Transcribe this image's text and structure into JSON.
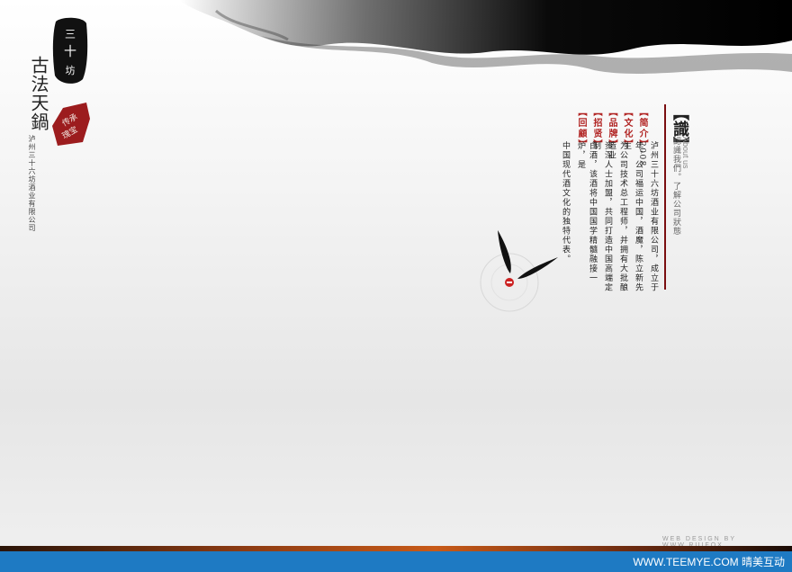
{
  "brand": {
    "logo_text": "三十六坊",
    "title": "古法天鍋",
    "seal_text": "传承·瑰宝",
    "company_name": "泸州三十六坊酒业有限公司"
  },
  "about": {
    "heading": "【識】",
    "english": "About us",
    "subtitle": "認識我們。了解公司狀態"
  },
  "nav": [
    {
      "label": "【简介】"
    },
    {
      "label": "【文化】"
    },
    {
      "label": "【品牌】"
    },
    {
      "label": "【招贤】"
    },
    {
      "label": "【回顧】"
    }
  ],
  "body_columns": [
    "泸州三十六坊酒业有限公司，成立于2008",
    "年，公司福运中国，酒魔，陈立新先生",
    "为公司技术总工程师，并拥有大批酿造业",
    "资深人士加盟，共同打造中国高端定制",
    "白酒，该酒将中国国学精髓融接一炉，是",
    "中国现代酒文化的独特代表。"
  ],
  "credit": "WEB DESIGN BY WWW.RUIFOX",
  "footer": {
    "link": "WWW.TEEMYE.COM 晴美互动"
  },
  "colors": {
    "accent_red": "#b12423",
    "footer_blue": "#1e7ac3"
  }
}
